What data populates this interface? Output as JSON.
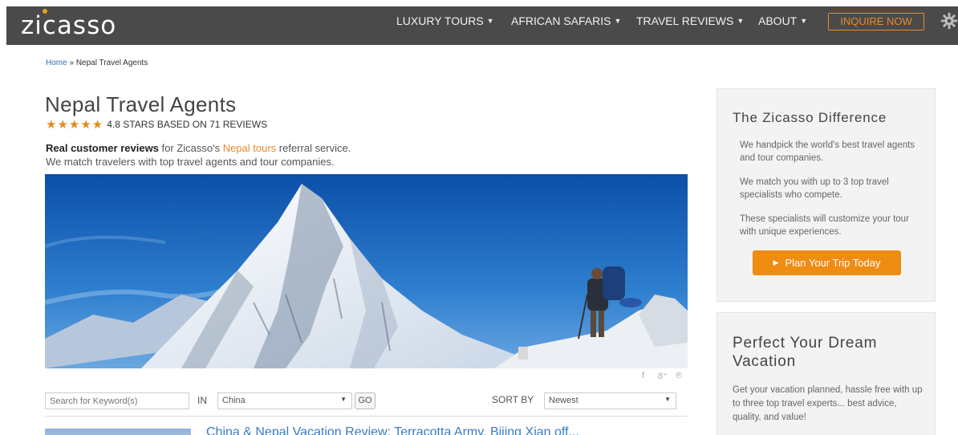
{
  "header": {
    "logo": "zicasso",
    "nav": [
      {
        "label": "LUXURY TOURS"
      },
      {
        "label": "AFRICAN SAFARIS"
      },
      {
        "label": "TRAVEL REVIEWS"
      },
      {
        "label": "ABOUT"
      }
    ],
    "inquire_label": "INQUIRE NOW",
    "brand_color": "#4a4a4a",
    "accent_color": "#e98a2b"
  },
  "breadcrumb": {
    "home": "Home",
    "separator": " » ",
    "current": "Nepal Travel Agents"
  },
  "page": {
    "title": "Nepal Travel Agents",
    "stars": "★★★★★",
    "rating_text": "4.8 STARS BASED ON 71 REVIEWS",
    "intro_bold": "Real customer reviews",
    "intro_mid": " for Zicasso's ",
    "intro_link": "Nepal tours",
    "intro_end": " referral service.",
    "intro_line2": "We match travelers with top travel agents and tour companies."
  },
  "social": {
    "facebook": "f",
    "gplus": "8⁺",
    "pinterest": "℗"
  },
  "filters": {
    "search_placeholder": "Search for Keyword(s)",
    "in_label": "IN",
    "country_value": "China",
    "go_label": "GO",
    "sort_label": "SORT BY",
    "sort_value": "Newest"
  },
  "review_preview": {
    "title": "China & Nepal Vacation Review: Terracotta Army, Bijing Xian off..."
  },
  "sidebar": {
    "difference": {
      "title": "The Zicasso Difference",
      "p1": "We handpick the world's best travel agents and tour companies.",
      "p2": "We match you with up to 3 top travel specialists who compete.",
      "p3": "These specialists will customize your tour with unique experiences.",
      "cta": "Plan Your Trip Today"
    },
    "dream": {
      "title": "Perfect Your Dream Vacation",
      "text": "Get your vacation planned, hassle free with up to three top travel experts... best advice, quality, and value!"
    }
  }
}
